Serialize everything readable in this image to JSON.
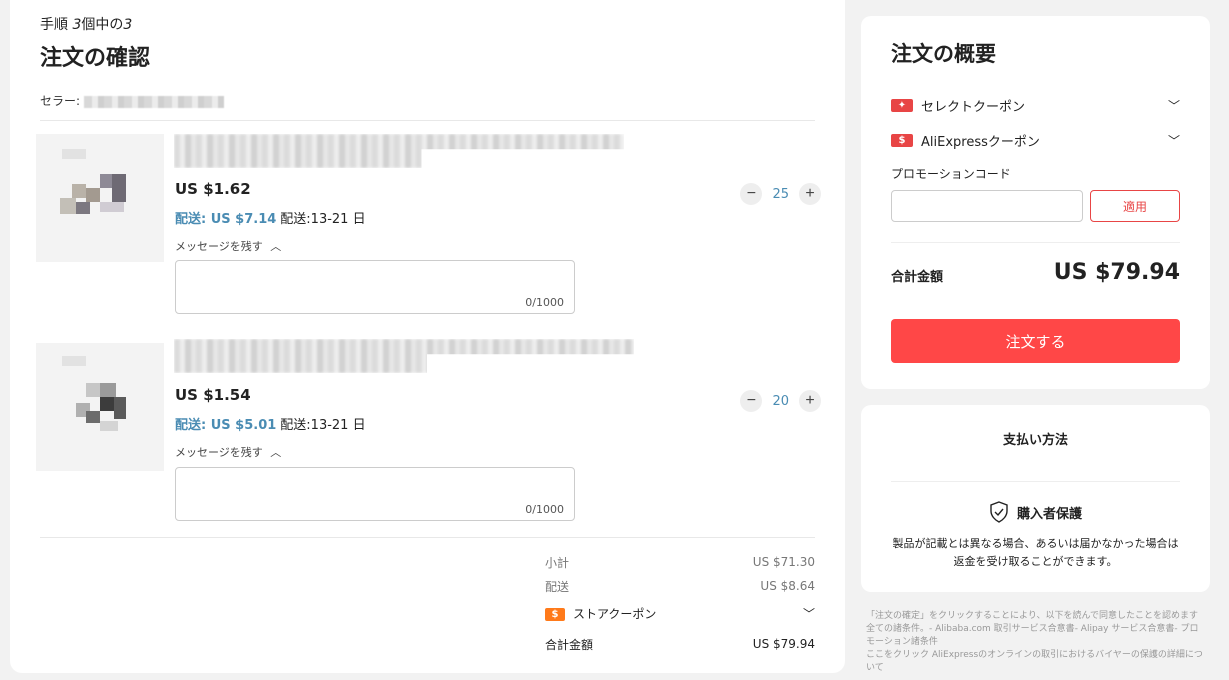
{
  "header": {
    "step_prefix": "手順",
    "step_current": "3",
    "step_mid": "個中の",
    "step_total": "3",
    "title": "注文の確認",
    "seller_label": "セラー:"
  },
  "items": [
    {
      "price": "US $1.62",
      "ship_fee": "配送: US $7.14",
      "ship_days": "配送:13-21 日",
      "message_toggle": "メッセージを残す",
      "message_count": "0/1000",
      "quantity": "25"
    },
    {
      "price": "US $1.54",
      "ship_fee": "配送: US $5.01",
      "ship_days": "配送:13-21 日",
      "message_toggle": "メッセージを残す",
      "message_count": "0/1000",
      "quantity": "20"
    }
  ],
  "store_summary": {
    "subtotal_label": "小計",
    "subtotal_value": "US $71.30",
    "shipping_label": "配送",
    "shipping_value": "US $8.64",
    "store_coupon_label": "ストアクーポン",
    "total_label": "合計金額",
    "total_value": "US $79.94"
  },
  "order_summary": {
    "title": "注文の概要",
    "select_coupon": "セレクトクーポン",
    "aliexpress_coupon": "AliExpressクーポン",
    "promo_label": "プロモーションコード",
    "promo_placeholder": "",
    "apply_label": "適用",
    "total_label": "合計金額",
    "total_value": "US $79.94",
    "order_button": "注文する"
  },
  "payment": {
    "title": "支払い方法",
    "protection_title": "購入者保護",
    "protection_text": "製品が記載とは異なる場合、あるいは届かなかった場合は返金を受け取ることができます。"
  },
  "legal": {
    "line1": "「注文の確定」をクリックすることにより、以下を読んで同意したことを認めます 全ての諸条件。",
    "link1": "- Alibaba.com 取引サービス合意書",
    "link2": "- Alipay サービス合意書",
    "link3": "- プロモーション諸条件",
    "click_here": "ここをクリック",
    "line2": " AliExpressのオンラインの取引におけるバイヤーの保護の詳細について"
  },
  "colors": {
    "accent_red": "#ff4747",
    "link_blue": "#4a8cb3",
    "coupon_orange": "#ff7a1a"
  },
  "icons": {
    "qty_minus": "minus-icon",
    "qty_plus": "plus-icon",
    "chevron": "chevron-down-icon",
    "shield": "shield-check-icon",
    "coupon": "coupon-icon"
  }
}
